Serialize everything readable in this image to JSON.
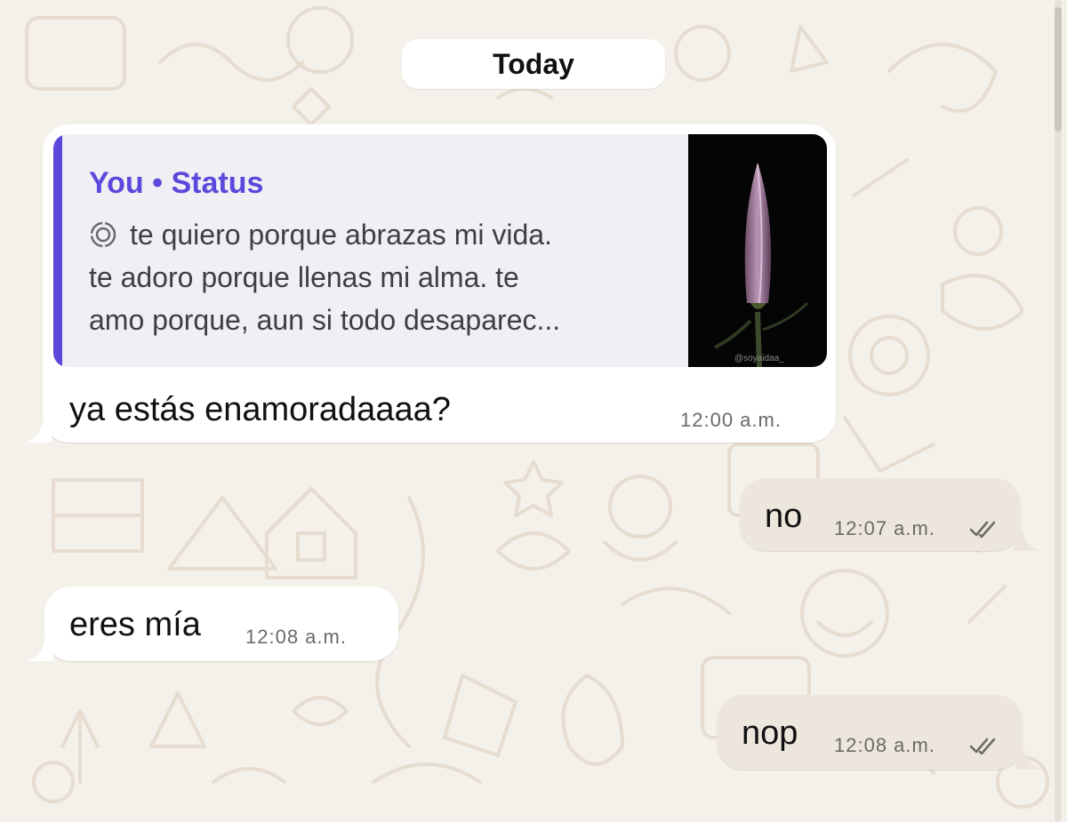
{
  "date_separator": {
    "label": "Today"
  },
  "messages": [
    {
      "direction": "incoming",
      "reply_to": {
        "author": "You • Status",
        "preview_lines": [
          "te quiero porque abrazas mi vida.",
          "te adoro porque llenas mi alma. te",
          "amo porque, aun si todo desaparec..."
        ],
        "thumbnail": {
          "subject": "pink lily bud on black background",
          "caption": "@soyaidaa_"
        }
      },
      "text": "ya estás enamoradaaaa?",
      "time": "12:00 a.m."
    },
    {
      "direction": "outgoing",
      "text": "no",
      "time": "12:07 a.m.",
      "status": "read-double-check"
    },
    {
      "direction": "incoming",
      "text": "eres mía",
      "time": "12:08 a.m."
    },
    {
      "direction": "outgoing",
      "text": "nop",
      "time": "12:08 a.m.",
      "status": "read-double-check"
    }
  ],
  "colors": {
    "wallpaper": "#f4f0ea",
    "incoming_bubble": "#ffffff",
    "outgoing_bubble": "#ece6dc",
    "quote_accent": "#5b48dc",
    "quote_background": "#f0eff3"
  }
}
